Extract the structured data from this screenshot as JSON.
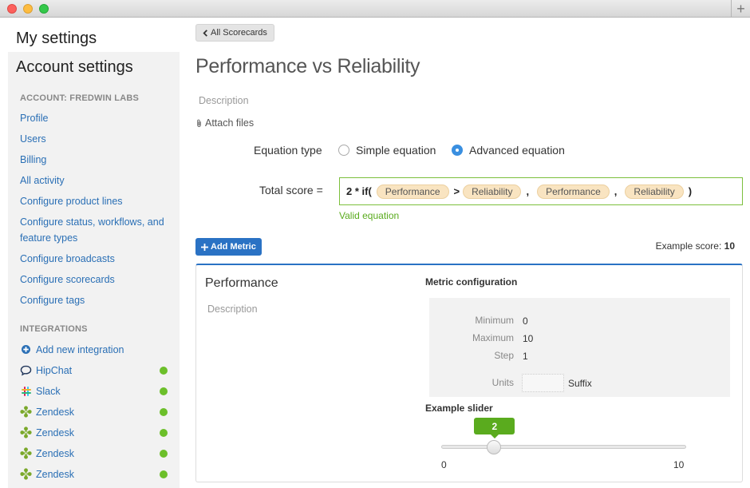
{
  "window": {
    "new_tab_label": "+"
  },
  "sidebar": {
    "my_settings": "My settings",
    "account_settings": "Account settings",
    "account_section": "ACCOUNT: FREDWIN LABS",
    "links": [
      "Profile",
      "Users",
      "Billing",
      "All activity",
      "Configure product lines",
      "Configure status, workflows, and feature types",
      "Configure broadcasts",
      "Configure scorecards",
      "Configure tags"
    ],
    "integrations_section": "INTEGRATIONS",
    "add_integration": "Add new integration",
    "integrations": [
      {
        "name": "HipChat",
        "icon": "hipchat-icon",
        "status_color": "#6cbf2a"
      },
      {
        "name": "Slack",
        "icon": "slack-icon",
        "status_color": "#6cbf2a"
      },
      {
        "name": "Zendesk",
        "icon": "zendesk-icon",
        "status_color": "#6cbf2a"
      },
      {
        "name": "Zendesk",
        "icon": "zendesk-icon",
        "status_color": "#6cbf2a"
      },
      {
        "name": "Zendesk",
        "icon": "zendesk-icon",
        "status_color": "#6cbf2a"
      },
      {
        "name": "Zendesk",
        "icon": "zendesk-icon",
        "status_color": "#6cbf2a"
      }
    ]
  },
  "main": {
    "back_label": "All Scorecards",
    "title": "Performance vs Reliability",
    "description_placeholder": "Description",
    "attach_files": "Attach files",
    "equation_type_label": "Equation type",
    "equation_options": [
      {
        "label": "Simple equation",
        "selected": false
      },
      {
        "label": "Advanced equation",
        "selected": true
      }
    ],
    "total_score_label": "Total score =",
    "equation": {
      "prefix": "2 * if(",
      "tokens": [
        "Performance",
        "Reliability",
        "Performance",
        "Reliability"
      ],
      "op_gt": ">",
      "comma": ",",
      "close": ")"
    },
    "valid_text": "Valid equation",
    "add_metric_label": "Add Metric",
    "example_score_label": "Example score:",
    "example_score_value": "10"
  },
  "metric": {
    "name": "Performance",
    "description_placeholder": "Description",
    "config_title": "Metric configuration",
    "minimum_label": "Minimum",
    "minimum_value": "0",
    "maximum_label": "Maximum",
    "maximum_value": "10",
    "step_label": "Step",
    "step_value": "1",
    "units_label": "Units",
    "units_value": "",
    "suffix_label": "Suffix",
    "slider_title": "Example slider",
    "slider_value": 2,
    "slider_min": "0",
    "slider_max": "10"
  },
  "colors": {
    "accent": "#2a72c4",
    "success": "#5aab1e",
    "link": "#2a6fb5"
  }
}
